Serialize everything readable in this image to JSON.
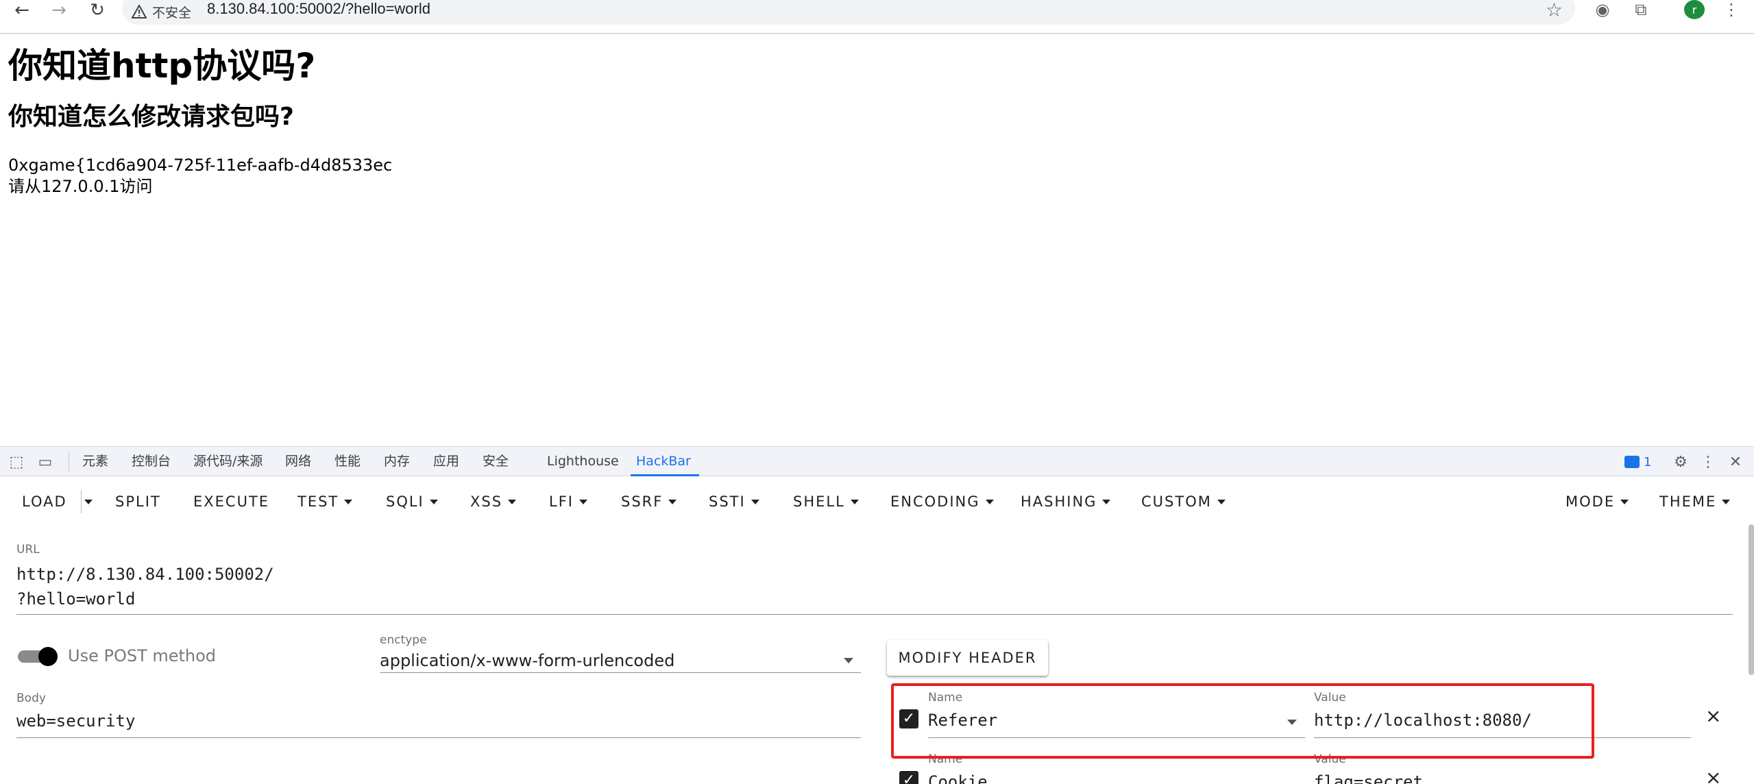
{
  "browser": {
    "security_label": "不安全",
    "url": "8.130.84.100:50002/?hello=world",
    "avatar_letter": "r"
  },
  "page": {
    "h1": "你知道http协议吗?",
    "h2": "你知道怎么修改请求包吗?",
    "lines": [
      "0xgame{1cd6a904-725f-11ef-aafb-d4d8533ec",
      "请从127.0.0.1访问"
    ]
  },
  "devtools": {
    "tabs": [
      "元素",
      "控制台",
      "源代码/来源",
      "网络",
      "性能",
      "内存",
      "应用",
      "安全",
      "Lighthouse",
      "HackBar"
    ],
    "active_tab": "HackBar",
    "message_count": "1"
  },
  "hackbar": {
    "toolbar": {
      "load": "LOAD",
      "split": "SPLIT",
      "execute": "EXECUTE",
      "test": "TEST",
      "sqli": "SQLI",
      "xss": "XSS",
      "lfi": "LFI",
      "ssrf": "SSRF",
      "ssti": "SSTI",
      "shell": "SHELL",
      "encoding": "ENCODING",
      "hashing": "HASHING",
      "custom": "CUSTOM",
      "mode": "MODE",
      "theme": "THEME"
    },
    "url_label": "URL",
    "url_value": "http://8.130.84.100:50002/\n?hello=world",
    "post_label": "Use POST method",
    "post_enabled": true,
    "enctype_label": "enctype",
    "enctype_value": "application/x-www-form-urlencoded",
    "body_label": "Body",
    "body_value": "web=security",
    "modify_header_label": "MODIFY HEADER",
    "headers": [
      {
        "name_label": "Name",
        "name": "Referer",
        "value_label": "Value",
        "value": "http://localhost:8080/",
        "checked": true
      },
      {
        "name_label": "Name",
        "name": "Cookie",
        "value_label": "Value",
        "value": "flag=secret",
        "checked": true
      }
    ]
  },
  "colors": {
    "accent": "#1a73e8",
    "highlight": "#e8201f"
  }
}
